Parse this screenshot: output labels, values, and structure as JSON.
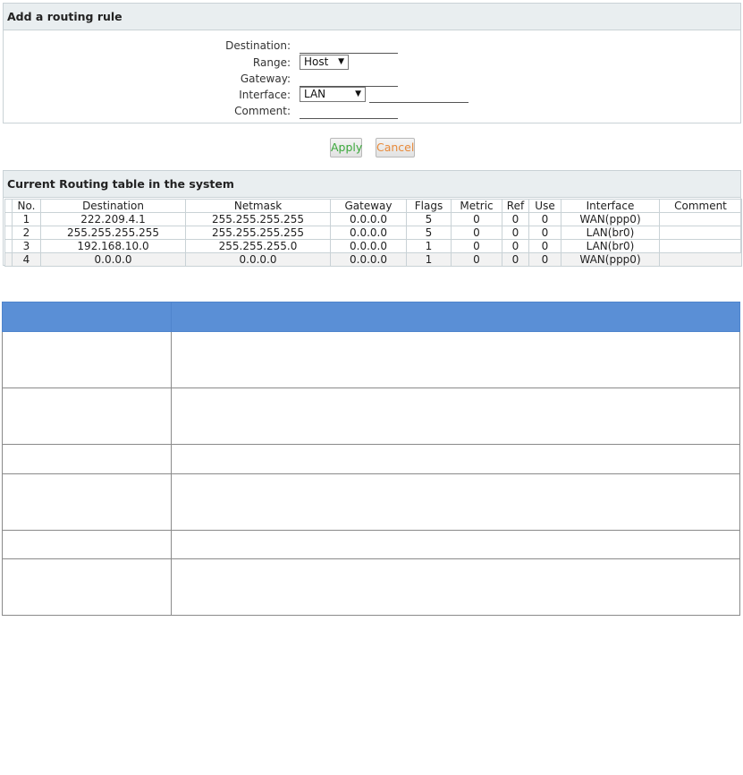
{
  "add_rule": {
    "title": "Add a routing rule",
    "fields": {
      "destination_label": "Destination:",
      "destination_value": "",
      "range_label": "Range:",
      "range_value": "Host",
      "gateway_label": "Gateway:",
      "gateway_value": "",
      "interface_label": "Interface:",
      "interface_value": "LAN",
      "interface_extra_value": "",
      "comment_label": "Comment:",
      "comment_value": ""
    }
  },
  "buttons": {
    "apply_label": "Apply",
    "cancel_label": "Cancel"
  },
  "routing_table": {
    "title": "Current Routing table in the system",
    "columns": [
      "No.",
      "Destination",
      "Netmask",
      "Gateway",
      "Flags",
      "Metric",
      "Ref",
      "Use",
      "Interface",
      "Comment"
    ],
    "rows": [
      [
        "1",
        "222.209.4.1",
        "255.255.255.255",
        "0.0.0.0",
        "5",
        "0",
        "0",
        "0",
        "WAN(ppp0)",
        ""
      ],
      [
        "2",
        "255.255.255.255",
        "255.255.255.255",
        "0.0.0.0",
        "5",
        "0",
        "0",
        "0",
        "LAN(br0)",
        ""
      ],
      [
        "3",
        "192.168.10.0",
        "255.255.255.0",
        "0.0.0.0",
        "1",
        "0",
        "0",
        "0",
        "LAN(br0)",
        ""
      ],
      [
        "4",
        "0.0.0.0",
        "0.0.0.0",
        "0.0.0.0",
        "1",
        "0",
        "0",
        "0",
        "WAN(ppp0)",
        ""
      ]
    ]
  },
  "colors": {
    "header_bg": "#e9eef0",
    "info_header": "#5a8fd6",
    "apply_text": "#3aa83a",
    "cancel_text": "#e88a3a"
  }
}
